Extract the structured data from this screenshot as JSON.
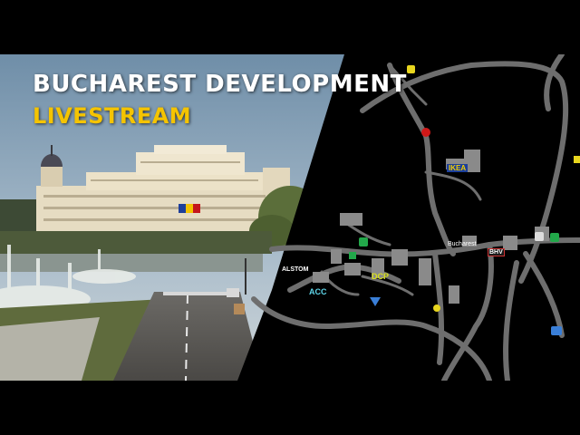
{
  "headline": {
    "line1": "BUCHAREST DEVELOPMENT",
    "line2": "LIVESTREAM"
  },
  "map": {
    "city_label": "Bucharest",
    "company_labels": {
      "ikea": "IKEA",
      "alstom": "ALSTOM",
      "acc": "ACC",
      "dcp": "DCP",
      "bhv": "BHV"
    },
    "icons": [
      "gas-station-icon",
      "road-marker-icon",
      "parking-icon",
      "fuel-icon",
      "hotel-icon",
      "service-icon",
      "garage-icon",
      "recruitment-icon",
      "company-icon"
    ]
  },
  "colors": {
    "accent_yellow": "#f5c400",
    "title_white": "#ffffff",
    "map_bg": "#000000",
    "road": "#6e6e6e",
    "building": "#8a8a8a"
  }
}
